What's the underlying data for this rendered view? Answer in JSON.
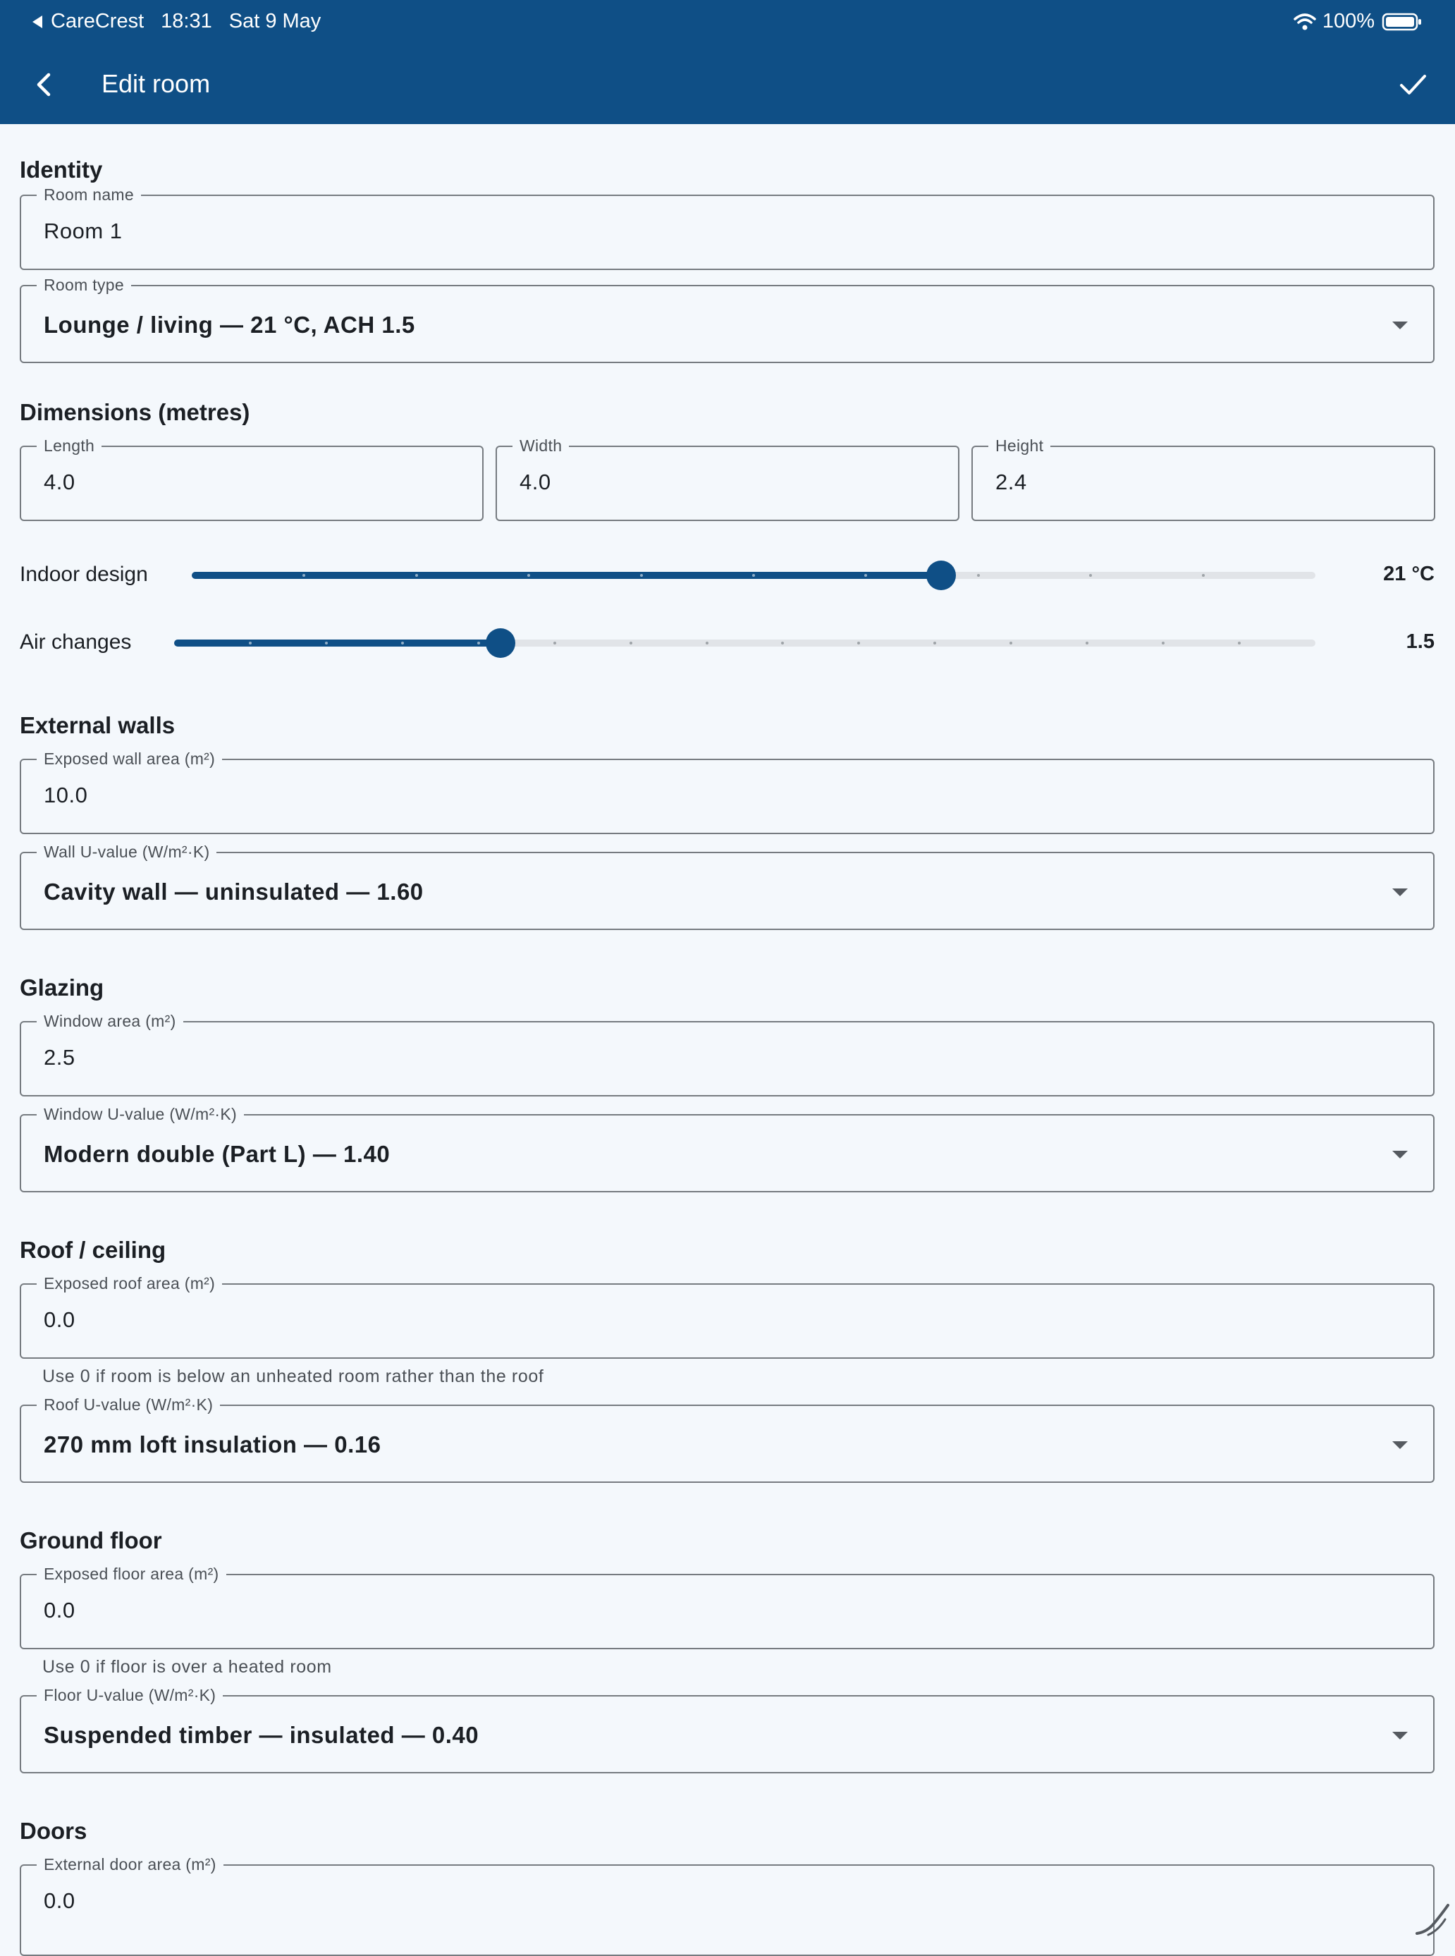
{
  "status": {
    "app": "CareCrest",
    "time": "18:31",
    "date": "Sat 9 May",
    "battery": "100%"
  },
  "appbar": {
    "title": "Edit room"
  },
  "identity": {
    "section": "Identity",
    "room_name": {
      "label": "Room name",
      "value": "Room 1"
    },
    "room_type": {
      "label": "Room type",
      "value": "Lounge / living — 21 °C, ACH 1.5"
    }
  },
  "dimensions": {
    "section": "Dimensions (metres)",
    "length": {
      "label": "Length",
      "value": "4.0"
    },
    "width": {
      "label": "Width",
      "value": "4.0"
    },
    "height": {
      "label": "Height",
      "value": "2.4"
    }
  },
  "sliders": {
    "indoor": {
      "label": "Indoor design",
      "value_text": "21 °C",
      "fraction": 0.667,
      "steps": 9
    },
    "air": {
      "label": "Air changes",
      "value_text": "1.5",
      "fraction": 0.2857,
      "steps": 14
    }
  },
  "walls": {
    "section": "External walls",
    "area": {
      "label": "Exposed wall area (m²)",
      "value": "10.0"
    },
    "uvalue": {
      "label": "Wall U-value (W/m²·K)",
      "value": "Cavity wall — uninsulated — 1.60"
    }
  },
  "glazing": {
    "section": "Glazing",
    "area": {
      "label": "Window area (m²)",
      "value": "2.5"
    },
    "uvalue": {
      "label": "Window U-value (W/m²·K)",
      "value": "Modern double (Part L) — 1.40"
    }
  },
  "roof": {
    "section": "Roof / ceiling",
    "area": {
      "label": "Exposed roof area (m²)",
      "value": "0.0"
    },
    "helper": "Use 0 if room is below an unheated room rather than the roof",
    "uvalue": {
      "label": "Roof U-value (W/m²·K)",
      "value": "270 mm loft insulation — 0.16"
    }
  },
  "floor": {
    "section": "Ground floor",
    "area": {
      "label": "Exposed floor area (m²)",
      "value": "0.0"
    },
    "helper": "Use 0 if floor is over a heated room",
    "uvalue": {
      "label": "Floor U-value (W/m²·K)",
      "value": "Suspended timber — insulated — 0.40"
    }
  },
  "doors": {
    "section": "Doors",
    "area": {
      "label": "External door area (m²)",
      "value": "0.0"
    }
  },
  "colors": {
    "primary": "#0f4f86",
    "background": "#f4f8fc",
    "track": "#e1e4e8"
  }
}
